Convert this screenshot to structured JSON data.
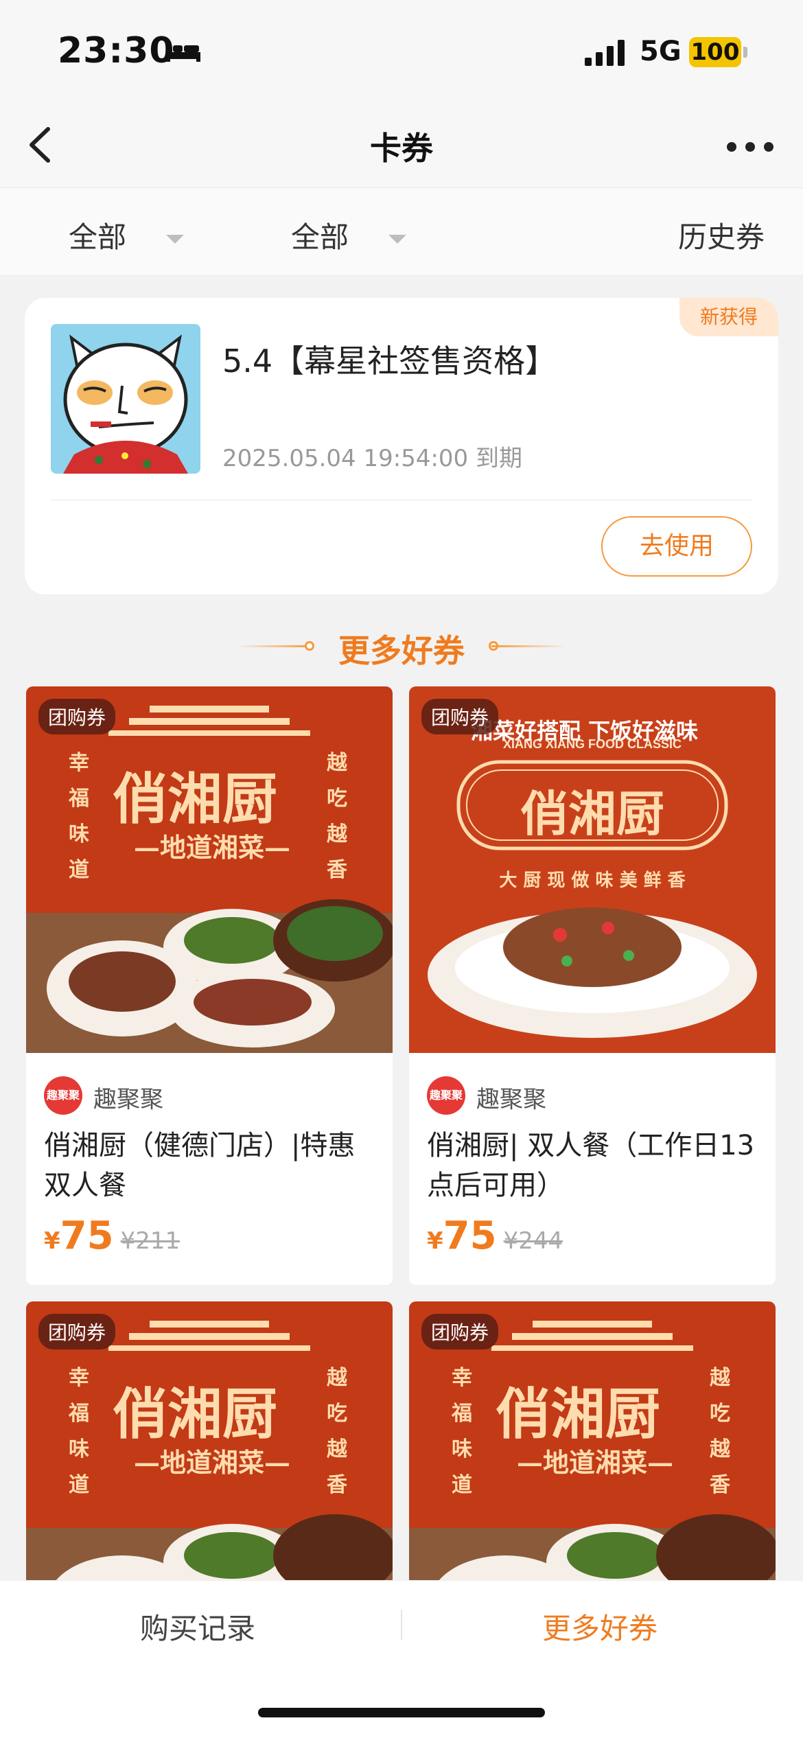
{
  "status_bar": {
    "time": "23:30",
    "network": "5G",
    "battery": "100"
  },
  "nav": {
    "title": "卡券"
  },
  "filters": {
    "type": "全部",
    "status": "全部",
    "history": "历史券"
  },
  "coupon": {
    "badge": "新获得",
    "title": "5.4【幕星社签售资格】",
    "expiry": "2025.05.04 19:54:00 到期",
    "use_button": "去使用"
  },
  "section_title": "更多好券",
  "products": [
    {
      "tag": "团购券",
      "shop": "趣聚聚",
      "logo_text": "趣聚聚",
      "name": "俏湘厨（健德门店）|特惠双人餐",
      "currency": "¥",
      "price": "75",
      "original_price": "¥211",
      "poster": {
        "brand": "俏湘厨",
        "subtitle": "—地道湘菜—",
        "left": "幸福味道",
        "right": "越吃越香"
      }
    },
    {
      "tag": "团购券",
      "shop": "趣聚聚",
      "logo_text": "趣聚聚",
      "name": "俏湘厨| 双人餐（工作日13点后可用）",
      "currency": "¥",
      "price": "75",
      "original_price": "¥244",
      "poster": {
        "brand": "俏湘厨",
        "slogan": "湘菜好搭配  下饭好滋味",
        "eng": "XIANG XIANG FOOD CLASSIC",
        "row": "大 厨 现 做   味 美 鲜 香"
      }
    },
    {
      "tag": "团购券",
      "poster": {
        "brand": "俏湘厨",
        "subtitle": "—地道湘菜—",
        "left": "幸福味道",
        "right": "越吃越香"
      }
    },
    {
      "tag": "团购券",
      "poster": {
        "brand": "俏湘厨",
        "subtitle": "—地道湘菜—",
        "left": "幸福味道",
        "right": "越吃越香"
      }
    }
  ],
  "bottom_tabs": {
    "records": "购买记录",
    "more": "更多好券"
  },
  "colors": {
    "accent": "#f07b1e",
    "poster_red": "#c23a16"
  }
}
